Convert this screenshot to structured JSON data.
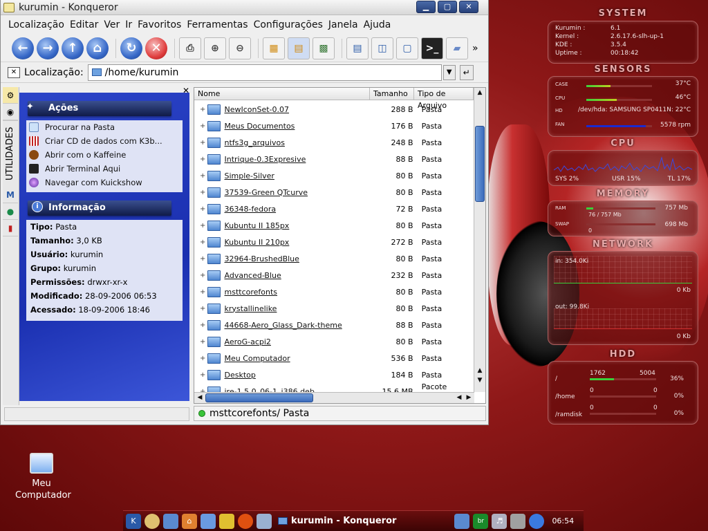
{
  "window": {
    "title": "kurumin - Konqueror",
    "buttons": [
      "▁",
      "▢",
      "✕"
    ]
  },
  "menu": [
    "Localização",
    "Editar",
    "Ver",
    "Ir",
    "Favoritos",
    "Ferramentas",
    "Configurações",
    "Janela",
    "Ajuda"
  ],
  "toolbar_icons": [
    "back-icon",
    "forward-icon",
    "up-icon",
    "home-icon",
    "reload-icon",
    "stop-icon",
    "print-icon",
    "zoom-in-icon",
    "zoom-out-icon",
    "icon-view-icon",
    "tree-view-icon",
    "detailed-view-icon",
    "split-horizontal-icon",
    "split-vertical-icon",
    "remove-view-icon",
    "terminal-icon",
    "trash-icon"
  ],
  "location": {
    "label": "Localização:",
    "value": "/home/kurumin"
  },
  "sidebar": {
    "vertical_tab": "UTILIDADES"
  },
  "actions": {
    "title": "Ações",
    "items": [
      "Procurar na Pasta",
      "Criar CD de dados com K3b...",
      "Abrir com o Kaffeine",
      "Abrir Terminal Aqui",
      "Navegar com Kuickshow"
    ]
  },
  "info": {
    "title": "Informação",
    "items": [
      {
        "k": "Tipo:",
        "v": "Pasta"
      },
      {
        "k": "Tamanho:",
        "v": "3,0 KB"
      },
      {
        "k": "Usuário:",
        "v": "kurumin"
      },
      {
        "k": "Grupo:",
        "v": "kurumin"
      },
      {
        "k": "Permissões:",
        "v": "drwxr-xr-x"
      },
      {
        "k": "Modificado:",
        "v": "28-09-2006 06:53"
      },
      {
        "k": "Acessado:",
        "v": "18-09-2006 18:46"
      }
    ]
  },
  "columns": [
    "Nome",
    "Tamanho",
    "Tipo de Arquivo"
  ],
  "files": [
    {
      "name": "NewIconSet-0.07",
      "size": "288 B",
      "type": "Pasta"
    },
    {
      "name": "Meus Documentos",
      "size": "176 B",
      "type": "Pasta"
    },
    {
      "name": "ntfs3g_arquivos",
      "size": "248 B",
      "type": "Pasta"
    },
    {
      "name": "Intrique-0.3Expresive",
      "size": "88 B",
      "type": "Pasta"
    },
    {
      "name": "Simple-Silver",
      "size": "80 B",
      "type": "Pasta"
    },
    {
      "name": "37539-Green QTcurve",
      "size": "80 B",
      "type": "Pasta"
    },
    {
      "name": "36348-fedora",
      "size": "72 B",
      "type": "Pasta"
    },
    {
      "name": "Kubuntu II 185px",
      "size": "80 B",
      "type": "Pasta"
    },
    {
      "name": "Kubuntu II 210px",
      "size": "272 B",
      "type": "Pasta"
    },
    {
      "name": "32964-BrushedBlue",
      "size": "80 B",
      "type": "Pasta"
    },
    {
      "name": "Advanced-Blue",
      "size": "232 B",
      "type": "Pasta"
    },
    {
      "name": "msttcorefonts",
      "size": "80 B",
      "type": "Pasta"
    },
    {
      "name": "krystallinelike",
      "size": "80 B",
      "type": "Pasta"
    },
    {
      "name": "44668-Aero_Glass_Dark-theme",
      "size": "88 B",
      "type": "Pasta"
    },
    {
      "name": "AeroG-acpi2",
      "size": "80 B",
      "type": "Pasta"
    },
    {
      "name": "Meu Computador",
      "size": "536 B",
      "type": "Pasta"
    },
    {
      "name": "Desktop",
      "size": "184 B",
      "type": "Pasta"
    },
    {
      "name": "jre-1.5.0_06-1_i386.deb",
      "size": "15,6 MB",
      "type": "Pacote Debian"
    }
  ],
  "status": "msttcorefonts/  Pasta",
  "desktop_icon": {
    "label1": "Meu",
    "label2": "Computador"
  },
  "taskbar": {
    "task": "kurumin - Konqueror",
    "clock": "06:54"
  },
  "karamba": {
    "system": {
      "title": "SYSTEM",
      "rows": [
        {
          "k": "Kurumin :",
          "v": "6.1"
        },
        {
          "k": "Kernel :",
          "v": "2.6.17.6-slh-up-1"
        },
        {
          "k": "KDE :",
          "v": "3.5.4"
        },
        {
          "k": "Uptime :",
          "v": "00:18:42"
        }
      ]
    },
    "sensors": {
      "title": "SENSORS",
      "rows": [
        {
          "k": "CASE",
          "v": "37°C"
        },
        {
          "k": "CPU",
          "v": "46°C"
        },
        {
          "k": "HD",
          "v": "/dev/hda: SAMSUNG SP0411N: 22°C"
        },
        {
          "k": "FAN",
          "v": "5578 rpm"
        }
      ],
      "levels": [
        0.37,
        0.46,
        0,
        0.9
      ]
    },
    "cpu": {
      "title": "CPU",
      "sys": "SYS 2%",
      "usr": "USR 15%",
      "tl": "TL 17%"
    },
    "memory": {
      "title": "MEMORY",
      "ram_label": "RAM",
      "ram_value": "757 Mb",
      "ram_used": "76 / 757 Mb",
      "swap_label": "SWAP",
      "swap_value": "698 Mb",
      "swap_used": "0",
      "ram_level": 0.1,
      "swap_level": 0
    },
    "network": {
      "title": "NETWORK",
      "in": "in: 354.0Ki",
      "in_value": "0 Kb",
      "out": "out: 99.8Ki",
      "out_value": "0 Kb"
    },
    "hdd": {
      "title": "HDD",
      "rows": [
        {
          "mount": "/",
          "used": "1762",
          "total": "5004",
          "pct": "36%",
          "level": 0.36
        },
        {
          "mount": "/home",
          "used": "0",
          "total": "0",
          "pct": "0%",
          "level": 0
        },
        {
          "mount": "/ramdisk",
          "used": "0",
          "total": "0",
          "pct": "0%",
          "level": 0
        }
      ]
    }
  }
}
